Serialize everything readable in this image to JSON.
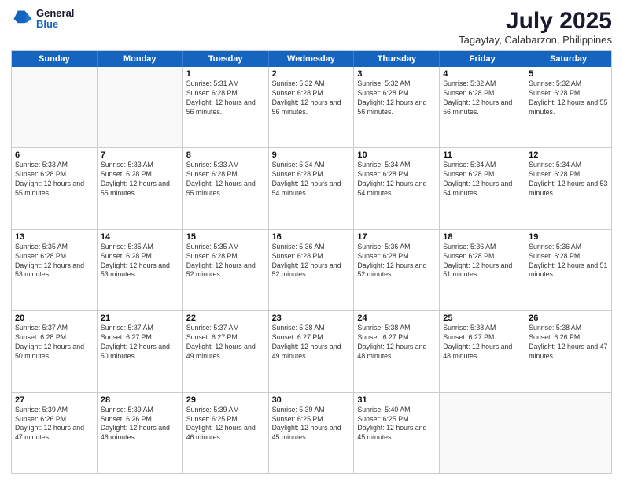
{
  "header": {
    "logo": {
      "general": "General",
      "blue": "Blue"
    },
    "title": "July 2025",
    "location": "Tagaytay, Calabarzon, Philippines"
  },
  "weekdays": [
    "Sunday",
    "Monday",
    "Tuesday",
    "Wednesday",
    "Thursday",
    "Friday",
    "Saturday"
  ],
  "weeks": [
    [
      {
        "day": "",
        "info": ""
      },
      {
        "day": "",
        "info": ""
      },
      {
        "day": "1",
        "info": "Sunrise: 5:31 AM\nSunset: 6:28 PM\nDaylight: 12 hours and 56 minutes."
      },
      {
        "day": "2",
        "info": "Sunrise: 5:32 AM\nSunset: 6:28 PM\nDaylight: 12 hours and 56 minutes."
      },
      {
        "day": "3",
        "info": "Sunrise: 5:32 AM\nSunset: 6:28 PM\nDaylight: 12 hours and 56 minutes."
      },
      {
        "day": "4",
        "info": "Sunrise: 5:32 AM\nSunset: 6:28 PM\nDaylight: 12 hours and 56 minutes."
      },
      {
        "day": "5",
        "info": "Sunrise: 5:32 AM\nSunset: 6:28 PM\nDaylight: 12 hours and 55 minutes."
      }
    ],
    [
      {
        "day": "6",
        "info": "Sunrise: 5:33 AM\nSunset: 6:28 PM\nDaylight: 12 hours and 55 minutes."
      },
      {
        "day": "7",
        "info": "Sunrise: 5:33 AM\nSunset: 6:28 PM\nDaylight: 12 hours and 55 minutes."
      },
      {
        "day": "8",
        "info": "Sunrise: 5:33 AM\nSunset: 6:28 PM\nDaylight: 12 hours and 55 minutes."
      },
      {
        "day": "9",
        "info": "Sunrise: 5:34 AM\nSunset: 6:28 PM\nDaylight: 12 hours and 54 minutes."
      },
      {
        "day": "10",
        "info": "Sunrise: 5:34 AM\nSunset: 6:28 PM\nDaylight: 12 hours and 54 minutes."
      },
      {
        "day": "11",
        "info": "Sunrise: 5:34 AM\nSunset: 6:28 PM\nDaylight: 12 hours and 54 minutes."
      },
      {
        "day": "12",
        "info": "Sunrise: 5:34 AM\nSunset: 6:28 PM\nDaylight: 12 hours and 53 minutes."
      }
    ],
    [
      {
        "day": "13",
        "info": "Sunrise: 5:35 AM\nSunset: 6:28 PM\nDaylight: 12 hours and 53 minutes."
      },
      {
        "day": "14",
        "info": "Sunrise: 5:35 AM\nSunset: 6:28 PM\nDaylight: 12 hours and 53 minutes."
      },
      {
        "day": "15",
        "info": "Sunrise: 5:35 AM\nSunset: 6:28 PM\nDaylight: 12 hours and 52 minutes."
      },
      {
        "day": "16",
        "info": "Sunrise: 5:36 AM\nSunset: 6:28 PM\nDaylight: 12 hours and 52 minutes."
      },
      {
        "day": "17",
        "info": "Sunrise: 5:36 AM\nSunset: 6:28 PM\nDaylight: 12 hours and 52 minutes."
      },
      {
        "day": "18",
        "info": "Sunrise: 5:36 AM\nSunset: 6:28 PM\nDaylight: 12 hours and 51 minutes."
      },
      {
        "day": "19",
        "info": "Sunrise: 5:36 AM\nSunset: 6:28 PM\nDaylight: 12 hours and 51 minutes."
      }
    ],
    [
      {
        "day": "20",
        "info": "Sunrise: 5:37 AM\nSunset: 6:28 PM\nDaylight: 12 hours and 50 minutes."
      },
      {
        "day": "21",
        "info": "Sunrise: 5:37 AM\nSunset: 6:27 PM\nDaylight: 12 hours and 50 minutes."
      },
      {
        "day": "22",
        "info": "Sunrise: 5:37 AM\nSunset: 6:27 PM\nDaylight: 12 hours and 49 minutes."
      },
      {
        "day": "23",
        "info": "Sunrise: 5:38 AM\nSunset: 6:27 PM\nDaylight: 12 hours and 49 minutes."
      },
      {
        "day": "24",
        "info": "Sunrise: 5:38 AM\nSunset: 6:27 PM\nDaylight: 12 hours and 48 minutes."
      },
      {
        "day": "25",
        "info": "Sunrise: 5:38 AM\nSunset: 6:27 PM\nDaylight: 12 hours and 48 minutes."
      },
      {
        "day": "26",
        "info": "Sunrise: 5:38 AM\nSunset: 6:26 PM\nDaylight: 12 hours and 47 minutes."
      }
    ],
    [
      {
        "day": "27",
        "info": "Sunrise: 5:39 AM\nSunset: 6:26 PM\nDaylight: 12 hours and 47 minutes."
      },
      {
        "day": "28",
        "info": "Sunrise: 5:39 AM\nSunset: 6:26 PM\nDaylight: 12 hours and 46 minutes."
      },
      {
        "day": "29",
        "info": "Sunrise: 5:39 AM\nSunset: 6:25 PM\nDaylight: 12 hours and 46 minutes."
      },
      {
        "day": "30",
        "info": "Sunrise: 5:39 AM\nSunset: 6:25 PM\nDaylight: 12 hours and 45 minutes."
      },
      {
        "day": "31",
        "info": "Sunrise: 5:40 AM\nSunset: 6:25 PM\nDaylight: 12 hours and 45 minutes."
      },
      {
        "day": "",
        "info": ""
      },
      {
        "day": "",
        "info": ""
      }
    ]
  ]
}
